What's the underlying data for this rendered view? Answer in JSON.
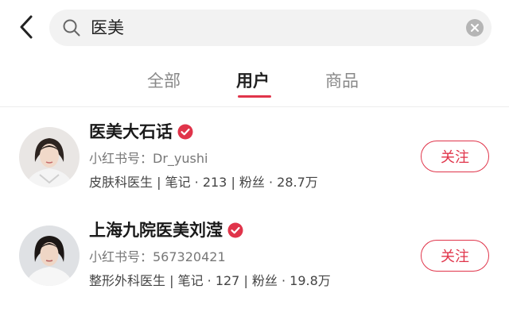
{
  "search": {
    "query": "医美"
  },
  "tabs": [
    {
      "label": "全部",
      "active": false
    },
    {
      "label": "用户",
      "active": true
    },
    {
      "label": "商品",
      "active": false
    }
  ],
  "users": [
    {
      "name": "医美大石话",
      "verified": true,
      "id_line": "小红书号：Dr_yushi",
      "meta": "皮肤科医生 | 笔记 · 213 | 粉丝 · 28.7万",
      "follow_label": "关注"
    },
    {
      "name": "上海九院医美刘滢",
      "verified": true,
      "id_line": "小红书号：567320421",
      "meta": "整形外科医生 | 笔记 · 127 | 粉丝 · 19.8万",
      "follow_label": "关注"
    }
  ],
  "colors": {
    "accent": "#e0344a",
    "muted": "#888888",
    "search_bg": "#f2f2f2"
  }
}
